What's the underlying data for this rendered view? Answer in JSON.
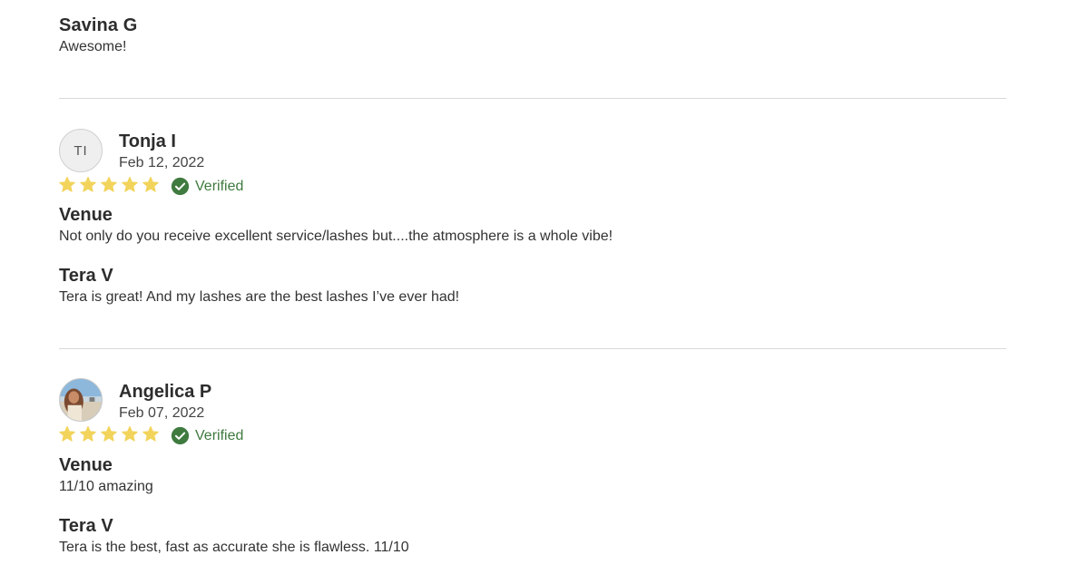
{
  "reviews": [
    {
      "name": "Savina G",
      "text": "Awesome!"
    },
    {
      "avatar_initials": "TI",
      "name": "Tonja I",
      "date": "Feb 12, 2022",
      "rating": 5,
      "verified_label": "Verified",
      "venue_title": "Venue",
      "venue_text": "Not only do you receive excellent service/lashes but....the atmosphere is a whole vibe!",
      "staff_title": "Tera V",
      "staff_text": "Tera is great! And my lashes are the best lashes I’ve ever had!"
    },
    {
      "avatar_icon": "user-photo",
      "name": "Angelica P",
      "date": "Feb 07, 2022",
      "rating": 5,
      "verified_label": "Verified",
      "venue_title": "Venue",
      "venue_text": "11/10 amazing",
      "staff_title": "Tera V",
      "staff_text": "Tera is the best, fast as accurate she is flawless. 11/10"
    }
  ],
  "colors": {
    "star": "#f2d45c",
    "verified": "#3f7a3f",
    "divider": "#d9d9d9"
  },
  "icons": {
    "star": "star-icon",
    "verified": "check-circle-icon"
  }
}
